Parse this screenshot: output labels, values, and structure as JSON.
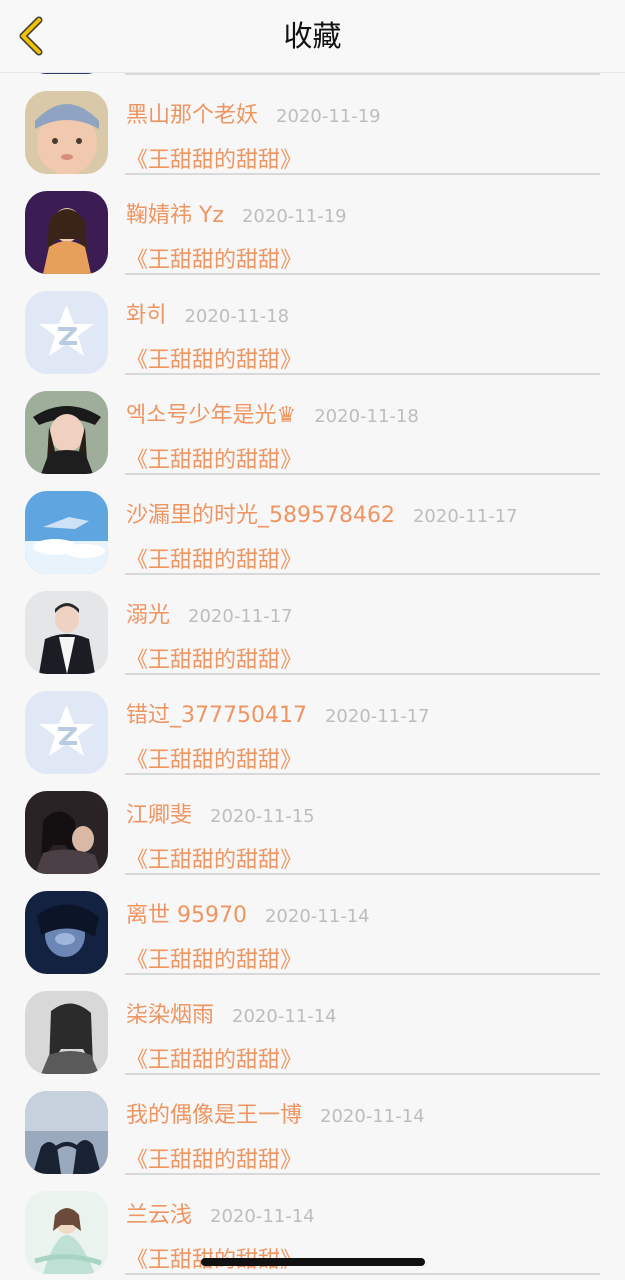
{
  "header": {
    "title": "收藏",
    "back_icon": "chevron-left-icon",
    "back_color": "#f2c200"
  },
  "colors": {
    "accent": "#ef9561",
    "date": "#bdbdbd",
    "background": "#f7f7f7"
  },
  "items": [
    {
      "name": "",
      "date": "",
      "book": "",
      "avatar_icon": "avatar-photo"
    },
    {
      "name": "黑山那个老妖",
      "date": "2020-11-19",
      "book": "《王甜甜的甜甜》",
      "avatar_icon": "avatar-photo"
    },
    {
      "name": "鞠婧祎 Yz",
      "date": "2020-11-19",
      "book": "《王甜甜的甜甜》",
      "avatar_icon": "avatar-photo"
    },
    {
      "name": "화히",
      "date": "2020-11-18",
      "book": "《王甜甜的甜甜》",
      "avatar_icon": "default-qq-avatar-icon"
    },
    {
      "name": "엑소号少年是光♛",
      "date": "2020-11-18",
      "book": "《王甜甜的甜甜》",
      "avatar_icon": "avatar-photo"
    },
    {
      "name": "沙漏里的时光_589578462",
      "date": "2020-11-17",
      "book": "《王甜甜的甜甜》",
      "avatar_icon": "avatar-photo"
    },
    {
      "name": "溺光",
      "date": "2020-11-17",
      "book": "《王甜甜的甜甜》",
      "avatar_icon": "avatar-photo"
    },
    {
      "name": "错过_377750417",
      "date": "2020-11-17",
      "book": "《王甜甜的甜甜》",
      "avatar_icon": "default-qq-avatar-icon"
    },
    {
      "name": "江卿斐",
      "date": "2020-11-15",
      "book": "《王甜甜的甜甜》",
      "avatar_icon": "avatar-photo"
    },
    {
      "name": "离世 95970",
      "date": "2020-11-14",
      "book": "《王甜甜的甜甜》",
      "avatar_icon": "avatar-photo"
    },
    {
      "name": "柒染烟雨",
      "date": "2020-11-14",
      "book": "《王甜甜的甜甜》",
      "avatar_icon": "avatar-photo"
    },
    {
      "name": "我的偶像是王一博",
      "date": "2020-11-14",
      "book": "《王甜甜的甜甜》",
      "avatar_icon": "avatar-photo"
    },
    {
      "name": "兰云浅",
      "date": "2020-11-14",
      "book": "《王甜甜的甜甜》",
      "avatar_icon": "avatar-photo"
    }
  ]
}
